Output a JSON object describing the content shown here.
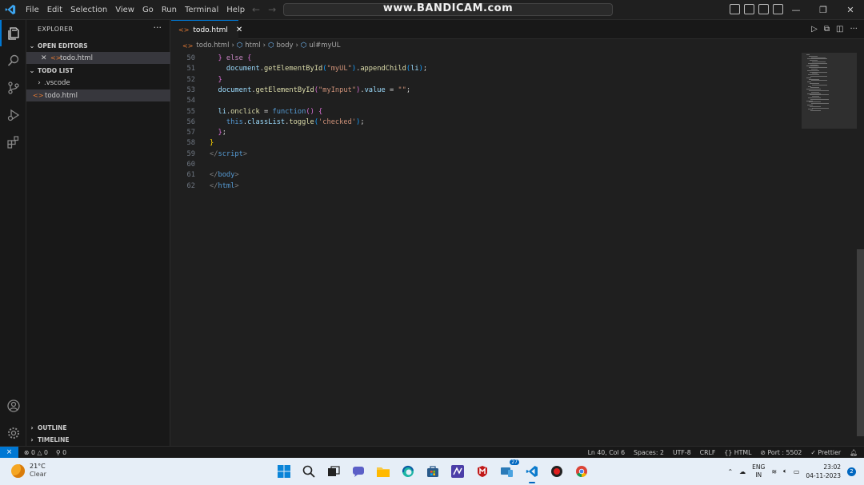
{
  "titlebar": {
    "menus": [
      "File",
      "Edit",
      "Selection",
      "View",
      "Go",
      "Run",
      "Terminal",
      "Help"
    ],
    "search_text": "www.BANDICAM.com",
    "back_icon": "arrow-left-icon",
    "forward_icon": "arrow-right-icon",
    "window_controls": [
      "—",
      "❐",
      "✕"
    ]
  },
  "activity_bar": {
    "items": [
      "explorer-icon",
      "search-icon",
      "source-control-icon",
      "run-debug-icon",
      "extensions-icon"
    ],
    "bottom": [
      "account-icon",
      "manage-gear-icon"
    ]
  },
  "sidebar": {
    "title": "EXPLORER",
    "more": "···",
    "open_editors": {
      "header": "OPEN EDITORS",
      "items": [
        {
          "name": "todo.html"
        }
      ]
    },
    "folder": {
      "header": "TODO LIST",
      "items": [
        {
          "name": ".vscode",
          "type": "folder"
        },
        {
          "name": "todo.html",
          "type": "file"
        }
      ]
    },
    "outline": "OUTLINE",
    "timeline": "TIMELINE"
  },
  "editor": {
    "tab": {
      "label": "todo.html",
      "close": "✕"
    },
    "breadcrumb": [
      "todo.html",
      "html",
      "body",
      "ul#myUL"
    ],
    "lines": [
      {
        "n": "50",
        "tokens": [
          [
            "  ",
            "txt"
          ],
          [
            "}",
            "br2"
          ],
          [
            " else ",
            "kw"
          ],
          [
            "{",
            "br2"
          ]
        ]
      },
      {
        "n": "51",
        "tokens": [
          [
            "    ",
            "txt"
          ],
          [
            "document",
            "var"
          ],
          [
            ".",
            "txt"
          ],
          [
            "getElementById",
            "fn"
          ],
          [
            "(",
            "br3"
          ],
          [
            "\"myUL\"",
            "str"
          ],
          [
            ")",
            "br3"
          ],
          [
            ".",
            "txt"
          ],
          [
            "appendChild",
            "fn"
          ],
          [
            "(",
            "br3"
          ],
          [
            "li",
            "var"
          ],
          [
            ")",
            "br3"
          ],
          [
            ";",
            "txt"
          ]
        ]
      },
      {
        "n": "52",
        "tokens": [
          [
            "  ",
            "txt"
          ],
          [
            "}",
            "br2"
          ]
        ]
      },
      {
        "n": "53",
        "tokens": [
          [
            "  ",
            "txt"
          ],
          [
            "document",
            "var"
          ],
          [
            ".",
            "txt"
          ],
          [
            "getElementById",
            "fn"
          ],
          [
            "(",
            "br2"
          ],
          [
            "\"myInput\"",
            "str"
          ],
          [
            ")",
            "br2"
          ],
          [
            ".",
            "txt"
          ],
          [
            "value",
            "var"
          ],
          [
            " = ",
            "txt"
          ],
          [
            "\"\"",
            "str"
          ],
          [
            ";",
            "txt"
          ]
        ]
      },
      {
        "n": "54",
        "tokens": []
      },
      {
        "n": "55",
        "tokens": [
          [
            "  ",
            "txt"
          ],
          [
            "li",
            "var"
          ],
          [
            ".",
            "txt"
          ],
          [
            "onclick",
            "fn"
          ],
          [
            " = ",
            "txt"
          ],
          [
            "function",
            "tag"
          ],
          [
            "() ",
            "br2"
          ],
          [
            "{",
            "br2"
          ]
        ]
      },
      {
        "n": "56",
        "tokens": [
          [
            "    ",
            "txt"
          ],
          [
            "this",
            "this"
          ],
          [
            ".",
            "txt"
          ],
          [
            "classList",
            "var"
          ],
          [
            ".",
            "txt"
          ],
          [
            "toggle",
            "fn"
          ],
          [
            "(",
            "br3"
          ],
          [
            "'checked'",
            "str"
          ],
          [
            ")",
            "br3"
          ],
          [
            ";",
            "txt"
          ]
        ]
      },
      {
        "n": "57",
        "tokens": [
          [
            "  ",
            "txt"
          ],
          [
            "}",
            "br2"
          ],
          [
            ";",
            "txt"
          ]
        ]
      },
      {
        "n": "58",
        "tokens": [
          [
            "}",
            "br1"
          ]
        ]
      },
      {
        "n": "59",
        "tokens": [
          [
            "</",
            "pun"
          ],
          [
            "script",
            "tag"
          ],
          [
            ">",
            "pun"
          ]
        ]
      },
      {
        "n": "60",
        "tokens": []
      },
      {
        "n": "61",
        "tokens": [
          [
            "</",
            "pun"
          ],
          [
            "body",
            "tag"
          ],
          [
            ">",
            "pun"
          ]
        ]
      },
      {
        "n": "62",
        "tokens": [
          [
            "</",
            "pun"
          ],
          [
            "html",
            "tag"
          ],
          [
            ">",
            "pun"
          ]
        ]
      }
    ]
  },
  "statusbar": {
    "remote": "⨯",
    "errors": "0",
    "warnings": "0",
    "ports": "0",
    "position": "Ln 40, Col 6",
    "spaces": "Spaces: 2",
    "encoding": "UTF-8",
    "eol": "CRLF",
    "language": "HTML",
    "port": "Port : 5502",
    "prettier": "Prettier"
  },
  "taskbar": {
    "temperature": "21°C",
    "condition": "Clear",
    "apps": [
      "windows-start-icon",
      "search-icon",
      "task-view-icon",
      "chat-icon",
      "file-explorer-icon",
      "edge-icon",
      "store-icon",
      "vpn-icon",
      "mcafee-icon",
      "phone-link-icon",
      "vscode-icon",
      "record-icon",
      "chrome-icon"
    ],
    "phone_badge": "27",
    "lang_top": "ENG",
    "lang_bottom": "IN",
    "time": "23:02",
    "date": "04-11-2023",
    "notifications": "2"
  }
}
